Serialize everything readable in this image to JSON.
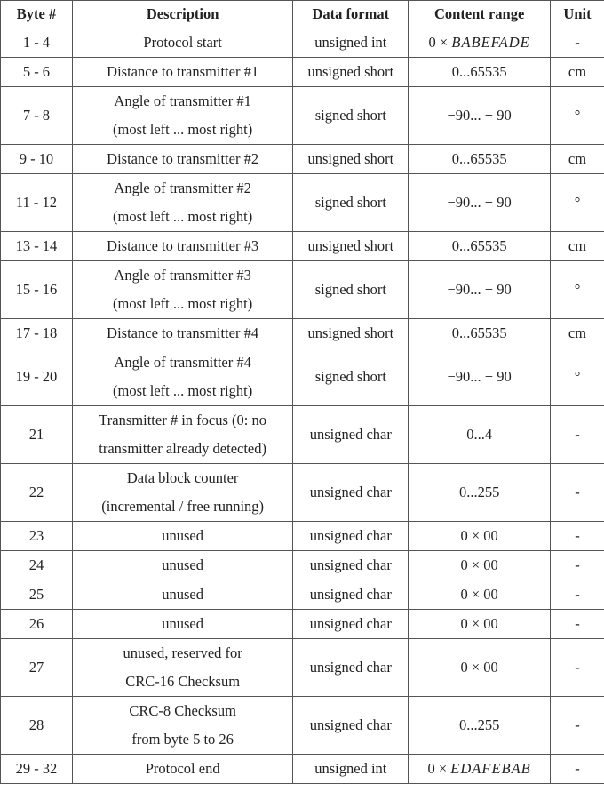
{
  "table": {
    "headers": [
      "Byte #",
      "Description",
      "Data format",
      "Content range",
      "Unit"
    ],
    "rows": [
      {
        "byte": "1 - 4",
        "desc": [
          "Protocol start"
        ],
        "format": "unsigned int",
        "range_prefix": "0 × ",
        "range": "BABEFADE",
        "range_italic": true,
        "unit": "-"
      },
      {
        "byte": "5 - 6",
        "desc": [
          "Distance to transmitter #1"
        ],
        "format": "unsigned short",
        "range_prefix": "",
        "range": "0...65535",
        "range_italic": false,
        "unit": "cm"
      },
      {
        "byte": "7 - 8",
        "desc": [
          "Angle of transmitter #1",
          "(most left ... most right)"
        ],
        "format": "signed short",
        "range_prefix": "",
        "range": "−90... + 90",
        "range_italic": false,
        "unit": "°"
      },
      {
        "byte": "9 - 10",
        "desc": [
          "Distance to transmitter #2"
        ],
        "format": "unsigned short",
        "range_prefix": "",
        "range": "0...65535",
        "range_italic": false,
        "unit": "cm"
      },
      {
        "byte": "11 - 12",
        "desc": [
          "Angle of transmitter #2",
          "(most left ... most right)"
        ],
        "format": "signed short",
        "range_prefix": "",
        "range": "−90... + 90",
        "range_italic": false,
        "unit": "°"
      },
      {
        "byte": "13 - 14",
        "desc": [
          "Distance to transmitter #3"
        ],
        "format": "unsigned short",
        "range_prefix": "",
        "range": "0...65535",
        "range_italic": false,
        "unit": "cm"
      },
      {
        "byte": "15 - 16",
        "desc": [
          "Angle of transmitter #3",
          "(most left ... most right)"
        ],
        "format": "signed short",
        "range_prefix": "",
        "range": "−90... + 90",
        "range_italic": false,
        "unit": "°"
      },
      {
        "byte": "17 - 18",
        "desc": [
          "Distance to transmitter #4"
        ],
        "format": "unsigned short",
        "range_prefix": "",
        "range": "0...65535",
        "range_italic": false,
        "unit": "cm"
      },
      {
        "byte": "19 - 20",
        "desc": [
          "Angle of transmitter #4",
          "(most left ... most right)"
        ],
        "format": "signed short",
        "range_prefix": "",
        "range": "−90... + 90",
        "range_italic": false,
        "unit": "°"
      },
      {
        "byte": "21",
        "desc": [
          "Transmitter # in focus (0: no",
          "transmitter already detected)"
        ],
        "format": "unsigned char",
        "range_prefix": "",
        "range": "0...4",
        "range_italic": false,
        "unit": "-"
      },
      {
        "byte": "22",
        "desc": [
          "Data block counter",
          "(incremental / free running)"
        ],
        "format": "unsigned char",
        "range_prefix": "",
        "range": "0...255",
        "range_italic": false,
        "unit": "-"
      },
      {
        "byte": "23",
        "desc": [
          "unused"
        ],
        "format": "unsigned char",
        "range_prefix": "",
        "range": "0 × 00",
        "range_italic": false,
        "unit": "-"
      },
      {
        "byte": "24",
        "desc": [
          "unused"
        ],
        "format": "unsigned char",
        "range_prefix": "",
        "range": "0 × 00",
        "range_italic": false,
        "unit": "-"
      },
      {
        "byte": "25",
        "desc": [
          "unused"
        ],
        "format": "unsigned char",
        "range_prefix": "",
        "range": "0 × 00",
        "range_italic": false,
        "unit": "-"
      },
      {
        "byte": "26",
        "desc": [
          "unused"
        ],
        "format": "unsigned char",
        "range_prefix": "",
        "range": "0 × 00",
        "range_italic": false,
        "unit": "-"
      },
      {
        "byte": "27",
        "desc": [
          "unused, reserved for",
          "CRC-16 Checksum"
        ],
        "format": "unsigned char",
        "range_prefix": "",
        "range": "0 × 00",
        "range_italic": false,
        "unit": "-"
      },
      {
        "byte": "28",
        "desc": [
          "CRC-8 Checksum",
          "from byte 5 to 26"
        ],
        "format": "unsigned char",
        "range_prefix": "",
        "range": "0...255",
        "range_italic": false,
        "unit": "-"
      },
      {
        "byte": "29 - 32",
        "desc": [
          "Protocol end"
        ],
        "format": "unsigned int",
        "range_prefix": "0 × ",
        "range": "EDAFEBAB",
        "range_italic": true,
        "unit": "-"
      }
    ]
  }
}
